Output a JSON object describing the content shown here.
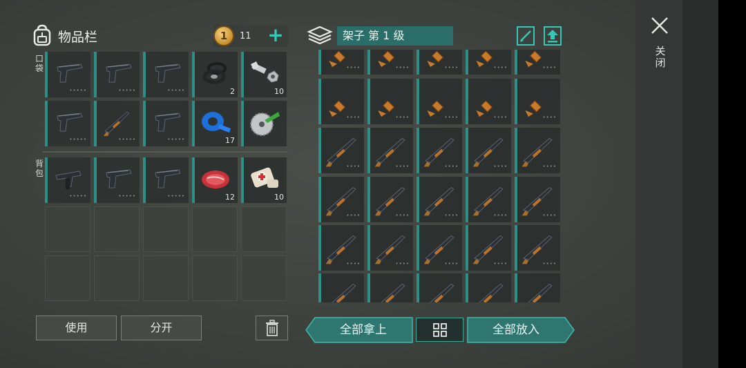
{
  "inventory": {
    "title": "物品栏",
    "coins": "11",
    "coin_symbol": "1",
    "pocket_label": "口袋",
    "backpack_label": "背包",
    "pocket_slots": [
      {
        "item": "pistol-icon",
        "qty": "",
        "dots": "•••••"
      },
      {
        "item": "pistol-icon",
        "qty": "",
        "dots": "•••••"
      },
      {
        "item": "pistol-icon",
        "qty": "",
        "dots": "•••••"
      },
      {
        "item": "rubber-rings-icon",
        "qty": "2",
        "dots": ""
      },
      {
        "item": "bolt-nut-icon",
        "qty": "10",
        "dots": ""
      },
      {
        "item": "pistol-icon",
        "qty": "",
        "dots": "•••••"
      },
      {
        "item": "shotgun-icon",
        "qty": "",
        "dots": "•••••"
      },
      {
        "item": "pistol-icon",
        "qty": "",
        "dots": "•••••"
      },
      {
        "item": "duct-tape-icon",
        "qty": "17",
        "dots": ""
      },
      {
        "item": "saw-blade-icon",
        "qty": "",
        "dots": ""
      }
    ],
    "backpack_slots": [
      {
        "item": "smg-icon",
        "qty": "",
        "dots": "•••••"
      },
      {
        "item": "pistol-icon",
        "qty": "",
        "dots": "•••••"
      },
      {
        "item": "pistol-icon",
        "qty": "",
        "dots": "•••••"
      },
      {
        "item": "raw-meat-icon",
        "qty": "12",
        "dots": ""
      },
      {
        "item": "bandage-icon",
        "qty": "10",
        "dots": ""
      }
    ],
    "use_label": "使用",
    "split_label": "分开"
  },
  "storage": {
    "title": "架子 第 1 级",
    "take_all_label": "全部拿上",
    "put_all_label": "全部放入",
    "rows": [
      "rifle-icon",
      "rifle-icon",
      "shotgun-icon",
      "shotgun-icon",
      "shotgun-icon",
      "shotgun-icon"
    ],
    "dots": "••••"
  },
  "close_label": "关闭",
  "colors": {
    "accent": "#35c9b5",
    "slot_stripe": "#2e8f86",
    "title_bar": "#2b6e69"
  }
}
